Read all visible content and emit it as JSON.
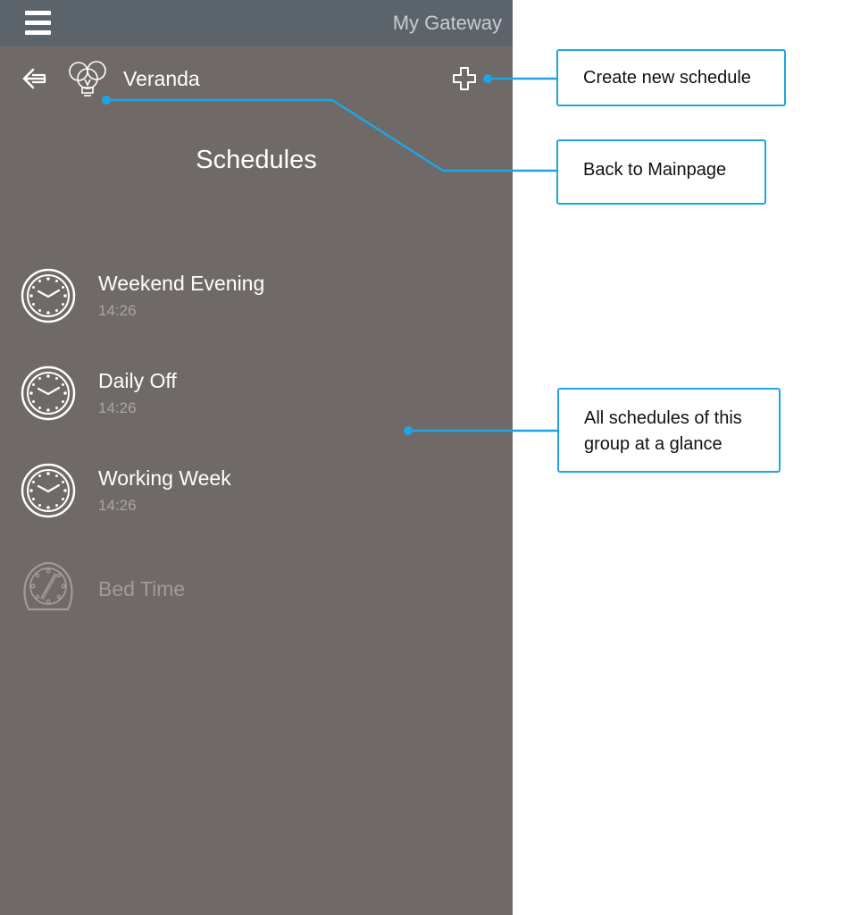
{
  "app": {
    "title": "My Gateway",
    "menu_icon": "hamburger-menu-icon"
  },
  "header": {
    "back_icon": "back-arrow-icon",
    "group_icon": "light-bulbs-icon",
    "group_name": "Veranda",
    "add_icon": "plus-icon"
  },
  "page": {
    "heading": "Schedules"
  },
  "schedules": [
    {
      "name": "Weekend Evening",
      "time": "14:26",
      "icon": "clock-icon",
      "enabled": true
    },
    {
      "name": "Daily Off",
      "time": "14:26",
      "icon": "clock-icon",
      "enabled": true
    },
    {
      "name": "Working Week",
      "time": "14:26",
      "icon": "clock-icon",
      "enabled": true
    },
    {
      "name": "Bed Time",
      "time": "",
      "icon": "timer-icon",
      "enabled": false
    }
  ],
  "callouts": [
    {
      "text": "Create new schedule"
    },
    {
      "text": "Back to Mainpage"
    },
    {
      "lines": [
        "All schedules of this",
        "group at a glance"
      ]
    }
  ],
  "colors": {
    "screen_background": "#6f6a67",
    "top_bar": "#5c646b",
    "callout_accent": "#1fa5e6",
    "disabled_text": "#a09b98"
  }
}
